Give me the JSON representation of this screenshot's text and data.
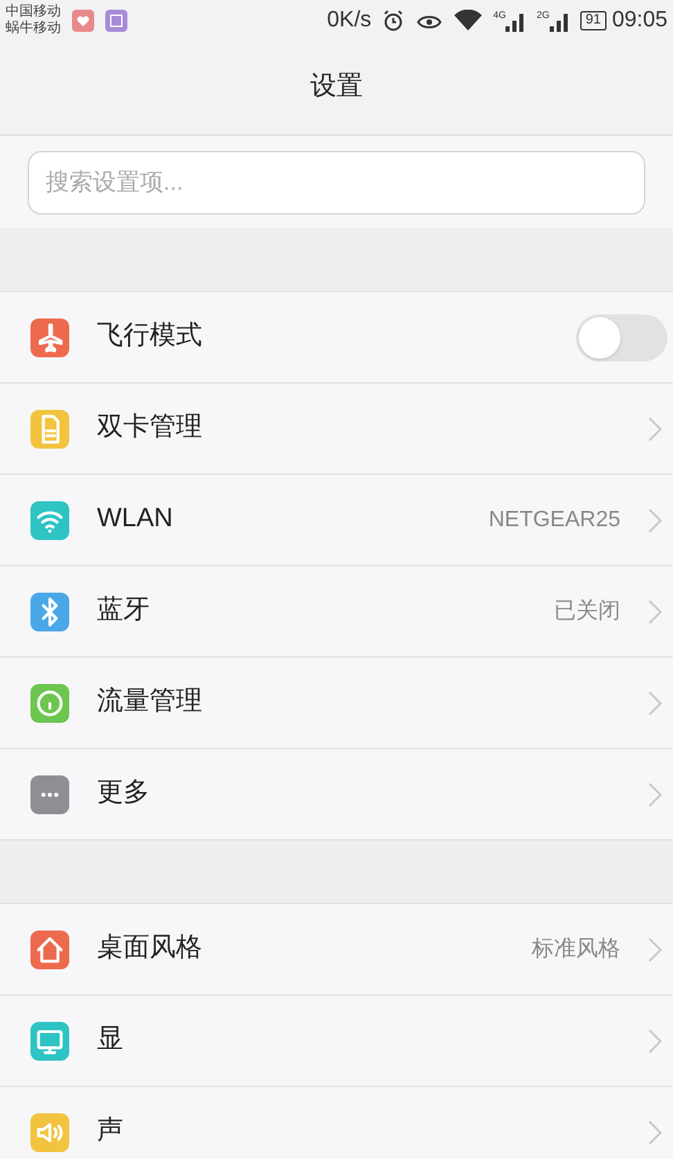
{
  "status_bar": {
    "carriers": [
      "中国移动",
      "蜗牛移动"
    ],
    "speed": "0K/s",
    "signals": [
      "4G",
      "2G"
    ],
    "battery": "91",
    "time": "09:05"
  },
  "title": "设置",
  "search": {
    "placeholder": "搜索设置项..."
  },
  "groups": [
    {
      "items": [
        {
          "kind": "toggle",
          "label": "飞行模式",
          "color": "#ee6a4f",
          "on": false
        },
        {
          "kind": "link",
          "label": "双卡管理",
          "color": "#f2c33f"
        },
        {
          "kind": "link",
          "label": "WLAN",
          "color": "#2ec4c4",
          "value": "NETGEAR25"
        },
        {
          "kind": "link",
          "label": "蓝牙",
          "color": "#4aa8e8",
          "value": "已关闭"
        },
        {
          "kind": "link",
          "label": "流量管理",
          "color": "#6cc64f"
        },
        {
          "kind": "link",
          "label": "更多",
          "color": "#8e8e93"
        }
      ]
    },
    {
      "items": [
        {
          "kind": "link",
          "label": "桌面风格",
          "color": "#ee6a4f",
          "value": "标准风格"
        },
        {
          "kind": "link",
          "label": "显",
          "color": "#2ec4c4"
        },
        {
          "kind": "link",
          "label": "声",
          "color": "#f2c33f"
        }
      ]
    }
  ]
}
